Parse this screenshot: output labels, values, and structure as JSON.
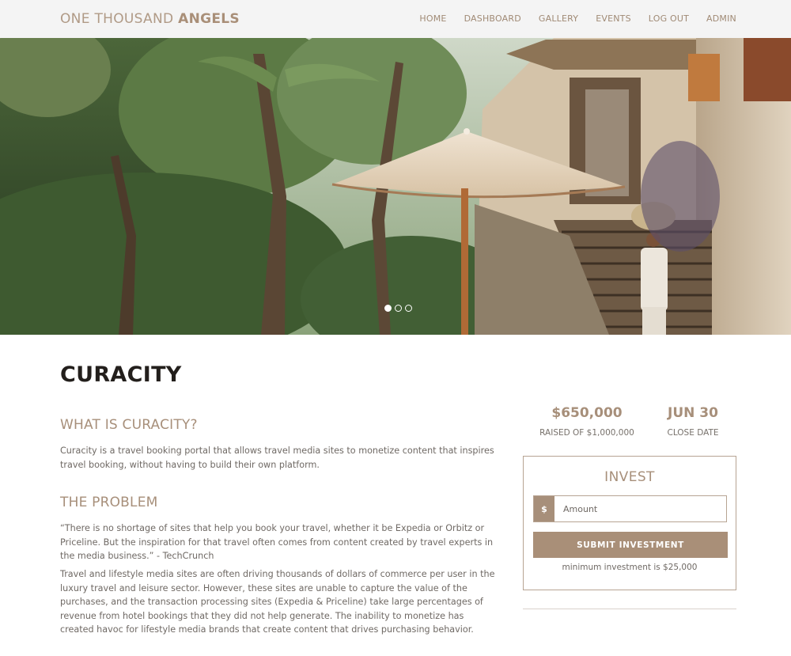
{
  "navbar": {
    "brand_light": "ONE THOUSAND",
    "brand_bold": "ANGELS",
    "items": [
      {
        "label": "HOME"
      },
      {
        "label": "DASHBOARD"
      },
      {
        "label": "GALLERY"
      },
      {
        "label": "EVENTS"
      },
      {
        "label": "LOG OUT"
      },
      {
        "label": "ADMIN"
      }
    ]
  },
  "hero": {
    "slide_count": 3,
    "active_slide": 1
  },
  "company": {
    "name": "CURACITY",
    "sections": [
      {
        "heading": "WHAT IS CURACITY?",
        "paragraphs": [
          "Curacity is a travel booking portal that allows travel media sites to monetize content that inspires travel booking, without having to build their own platform."
        ]
      },
      {
        "heading": "THE PROBLEM",
        "paragraphs": [
          "“There is no shortage of sites that help you book your travel, whether it be Expedia or Orbitz or Priceline. But the inspiration for that travel often comes from content created by travel experts in the media business.” - TechCrunch",
          "Travel and lifestyle media sites are often driving thousands of dollars of commerce per user in the luxury travel and leisure sector. However, these sites are unable to capture the value of the purchases, and the transaction processing sites (Expedia & Priceline) take large percentages of revenue from hotel bookings that they did not help generate. The inability to monetize has created havoc for lifestyle media brands that create content that drives purchasing behavior."
        ]
      }
    ]
  },
  "stats": {
    "raised_value": "$650,000",
    "raised_label": "RAISED OF $1,000,000",
    "close_value": "JUN 30",
    "close_label": "CLOSE DATE"
  },
  "invest": {
    "title": "INVEST",
    "currency_symbol": "$",
    "amount_placeholder": "Amount",
    "amount_value": "",
    "submit_label": "SUBMIT INVESTMENT",
    "min_note": "minimum investment is $25,000"
  },
  "colors": {
    "accent": "#a98f78",
    "navbar_bg": "#f4f4f4",
    "heading_dark": "#231f1c"
  },
  "icons": {
    "carousel_dot": "circle"
  }
}
